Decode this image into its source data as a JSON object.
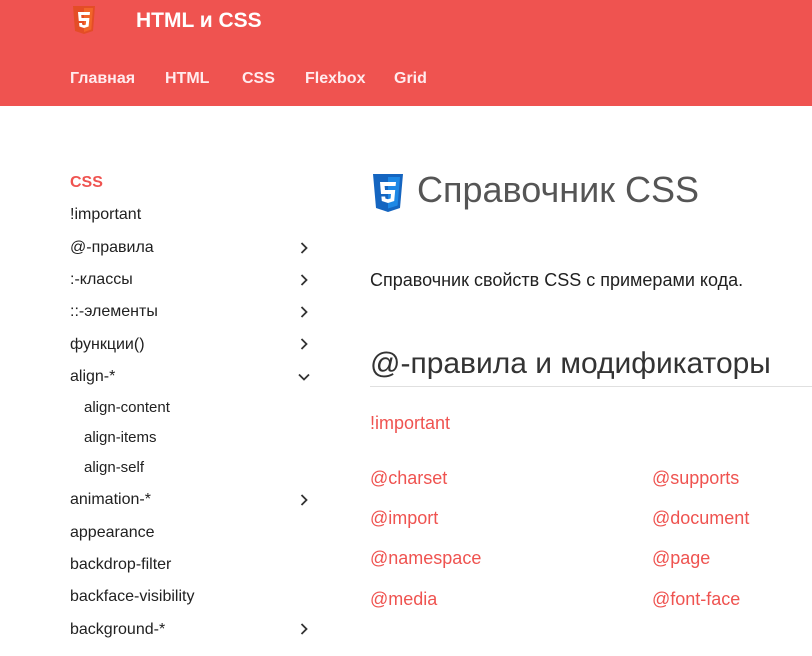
{
  "header": {
    "logo_icon": "html5-icon",
    "brand": "HTML и CSS",
    "nav": [
      {
        "label": "Главная"
      },
      {
        "label": "HTML"
      },
      {
        "label": "CSS"
      },
      {
        "label": "Flexbox"
      },
      {
        "label": "Grid"
      }
    ]
  },
  "sidebar": {
    "items": [
      {
        "label": "CSS",
        "active": true,
        "expandable": false
      },
      {
        "label": "!important",
        "expandable": false
      },
      {
        "label": "@-правила",
        "expandable": true
      },
      {
        "label": ":-классы",
        "expandable": true
      },
      {
        "label": "::-элементы",
        "expandable": true
      },
      {
        "label": "функции()",
        "expandable": true
      },
      {
        "label": "align-*",
        "expandable": true,
        "expanded": true,
        "children": [
          "align-content",
          "align-items",
          "align-self"
        ]
      },
      {
        "label": "animation-*",
        "expandable": true
      },
      {
        "label": "appearance",
        "expandable": false
      },
      {
        "label": "backdrop-filter",
        "expandable": false
      },
      {
        "label": "backface-visibility",
        "expandable": false
      },
      {
        "label": "background-*",
        "expandable": true
      }
    ]
  },
  "main": {
    "title_icon": "css3-icon",
    "title": "Справочник CSS",
    "lead": "Справочник свойств CSS с примерами кода.",
    "section": {
      "title": "@-правила и модификаторы",
      "important_link": "!important",
      "links_left": [
        "@charset",
        "@import",
        "@namespace",
        "@media"
      ],
      "links_right": [
        "@supports",
        "@document",
        "@page",
        "@font-face"
      ]
    }
  },
  "colors": {
    "accent": "#ef5350",
    "header_bg": "#ef5350",
    "css3_blue": "#1565c0"
  }
}
